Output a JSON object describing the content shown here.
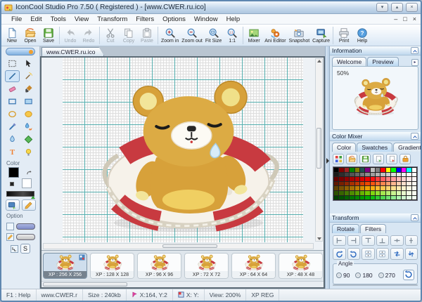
{
  "window": {
    "title": "IconCool Studio Pro 7.50 ( Registered ) - [www.CWER.ru.ico]",
    "min_glyph": "▾",
    "max_glyph": "▴",
    "close_glyph": "×"
  },
  "menubar": {
    "items": [
      "File",
      "Edit",
      "Tools",
      "View",
      "Transform",
      "Filters",
      "Options",
      "Window",
      "Help"
    ],
    "mdi": {
      "min": "–",
      "restore": "□",
      "close": "×"
    }
  },
  "toolbar": {
    "buttons": [
      {
        "label": "New",
        "icon": "new"
      },
      {
        "label": "Open",
        "icon": "open"
      },
      {
        "label": "Save",
        "icon": "save"
      },
      {
        "sep": true
      },
      {
        "label": "Undo",
        "icon": "undo",
        "disabled": true
      },
      {
        "label": "Redo",
        "icon": "redo",
        "disabled": true
      },
      {
        "sep": true
      },
      {
        "label": "Cut",
        "icon": "cut",
        "disabled": true
      },
      {
        "label": "Copy",
        "icon": "copy",
        "disabled": true
      },
      {
        "label": "Paste",
        "icon": "paste",
        "disabled": true
      },
      {
        "sep": true
      },
      {
        "label": "Zoom in",
        "icon": "zoom-in"
      },
      {
        "label": "Zoom out",
        "icon": "zoom-out"
      },
      {
        "label": "Fit Size",
        "icon": "fit-size"
      },
      {
        "label": "1:1",
        "icon": "one-to-one"
      },
      {
        "sep": true
      },
      {
        "label": "Mixer",
        "icon": "mixer"
      },
      {
        "label": "Ani Editor",
        "icon": "ani-editor"
      },
      {
        "label": "Snapshot",
        "icon": "snapshot"
      },
      {
        "label": "Capture",
        "icon": "capture"
      },
      {
        "sep": true
      },
      {
        "label": "Print",
        "icon": "print"
      },
      {
        "label": "Help",
        "icon": "help"
      }
    ]
  },
  "left_panel": {
    "color_label": "Color",
    "option_label": "Option",
    "s_label": "S",
    "foreground_color": "#000000",
    "background_color": "#ffffff",
    "tools": [
      {
        "name": "select"
      },
      {
        "name": "move"
      },
      {
        "name": "line",
        "active": true
      },
      {
        "name": "magic-wand"
      },
      {
        "name": "eraser"
      },
      {
        "name": "brush"
      },
      {
        "name": "rectangle"
      },
      {
        "name": "filled-rectangle"
      },
      {
        "name": "ellipse"
      },
      {
        "name": "filled-ellipse"
      },
      {
        "name": "eyedropper"
      },
      {
        "name": "color-replacer"
      },
      {
        "name": "blur"
      },
      {
        "name": "fill"
      },
      {
        "name": "text"
      },
      {
        "name": "spray"
      }
    ]
  },
  "document": {
    "tab_label": "www.CWER.ru.ico"
  },
  "info_panel": {
    "title": "Information",
    "tabs": [
      "Welcome",
      "Preview"
    ],
    "active_tab": "Preview",
    "zoom_label": "50%"
  },
  "color_mixer": {
    "title": "Color Mixer",
    "tabs": [
      "Color",
      "Swatches",
      "Gradient"
    ],
    "active_tab": "Swatches",
    "buttons": [
      "blend",
      "open",
      "save",
      "export",
      "import",
      "protect"
    ],
    "palette": [
      [
        "#000000",
        "#7f0000",
        "#9f2020",
        "#007f00",
        "#7f7f00",
        "#205050",
        "#7f007f",
        "#bfbfbf",
        "#7f7f7f",
        "#ff0000",
        "#ffff00",
        "#00ff00",
        "#0000ff",
        "#ff00ff",
        "#00ffff",
        "#ffffff"
      ],
      [
        "#1a1a1a",
        "#2d2d2d",
        "#404040",
        "#535353",
        "#666666",
        "#797979",
        "#8c8c8c",
        "#9f9f9f",
        "#b2b2b2",
        "#c0c0c0",
        "#cecece",
        "#dcdcdc",
        "#e6e6e6",
        "#efefef",
        "#f7f7f7",
        "#ffffff"
      ],
      [
        "#600000",
        "#780000",
        "#900000",
        "#a80000",
        "#c00000",
        "#d80000",
        "#f00000",
        "#ff1414",
        "#ff3c3c",
        "#ff6060",
        "#ff8282",
        "#ffa0a0",
        "#ffbcbc",
        "#ffd2d2",
        "#ffe6e6",
        "#fff4f4"
      ],
      [
        "#601800",
        "#782000",
        "#902800",
        "#a83000",
        "#c03800",
        "#d84000",
        "#f04800",
        "#ff5510",
        "#ff6e30",
        "#ff8750",
        "#ff9f70",
        "#ffb790",
        "#ffcdb0",
        "#ffdfcc",
        "#ffeee2",
        "#fff7f0"
      ],
      [
        "#604000",
        "#785000",
        "#906000",
        "#a87000",
        "#c08000",
        "#d89000",
        "#f0a000",
        "#ffad10",
        "#ffba30",
        "#ffc750",
        "#ffd470",
        "#ffdf90",
        "#ffe9b0",
        "#fff1cc",
        "#fff7e2",
        "#fffbf0"
      ],
      [
        "#2c5000",
        "#386400",
        "#447800",
        "#508c00",
        "#5ca000",
        "#68b400",
        "#74c800",
        "#82d810",
        "#93e030",
        "#a5e850",
        "#b7ee70",
        "#c9f390",
        "#d9f7b0",
        "#e7facc",
        "#f1fce2",
        "#f9fef0"
      ],
      [
        "#004000",
        "#005200",
        "#006400",
        "#007600",
        "#008800",
        "#009a00",
        "#00ac00",
        "#10c010",
        "#30cc30",
        "#50d850",
        "#70e270",
        "#90ec90",
        "#b0f3b0",
        "#ccf8cc",
        "#e2fbe2",
        "#f0fdf0"
      ]
    ]
  },
  "transform_panel": {
    "title": "Transform",
    "tabs": [
      "Rotate",
      "Filters"
    ],
    "active_tab": "Rotate",
    "align_buttons": [
      "align-left",
      "align-right",
      "align-top",
      "align-bottom",
      "center-horizontal",
      "center-vertical"
    ],
    "rotate_buttons": [
      "rotate-ccw",
      "rotate-cw",
      "spinner",
      "spinner",
      "flip-horizontal",
      "flip-vertical"
    ],
    "angle": {
      "label": "Angle",
      "options": [
        "90",
        "180",
        "270"
      ]
    }
  },
  "thumbnails": {
    "items": [
      {
        "label": "XP : 256 X 256",
        "selected": true
      },
      {
        "label": "XP : 128 X 128",
        "selected": false
      },
      {
        "label": "XP : 96 X 96",
        "selected": false
      },
      {
        "label": "XP : 72 X 72",
        "selected": false
      },
      {
        "label": "XP : 64 X 64",
        "selected": false
      },
      {
        "label": "XP : 48 X 48",
        "selected": false
      }
    ]
  },
  "statusbar": {
    "items": [
      {
        "text": "F1 : Help"
      },
      {
        "text": "www.CWER.r"
      },
      {
        "text": "Size : 240kb"
      },
      {
        "text": "X:164, Y:2",
        "icon": "position"
      },
      {
        "text": "X: Y:",
        "icon": "selection"
      },
      {
        "text": "View: 200%"
      },
      {
        "text": "XP REG"
      }
    ]
  },
  "colors": {
    "grid_major": "#56b0b0",
    "stripe_red": "#c83a40",
    "bear_gold": "#d7a13a",
    "accent_blue": "#4f86c0"
  }
}
